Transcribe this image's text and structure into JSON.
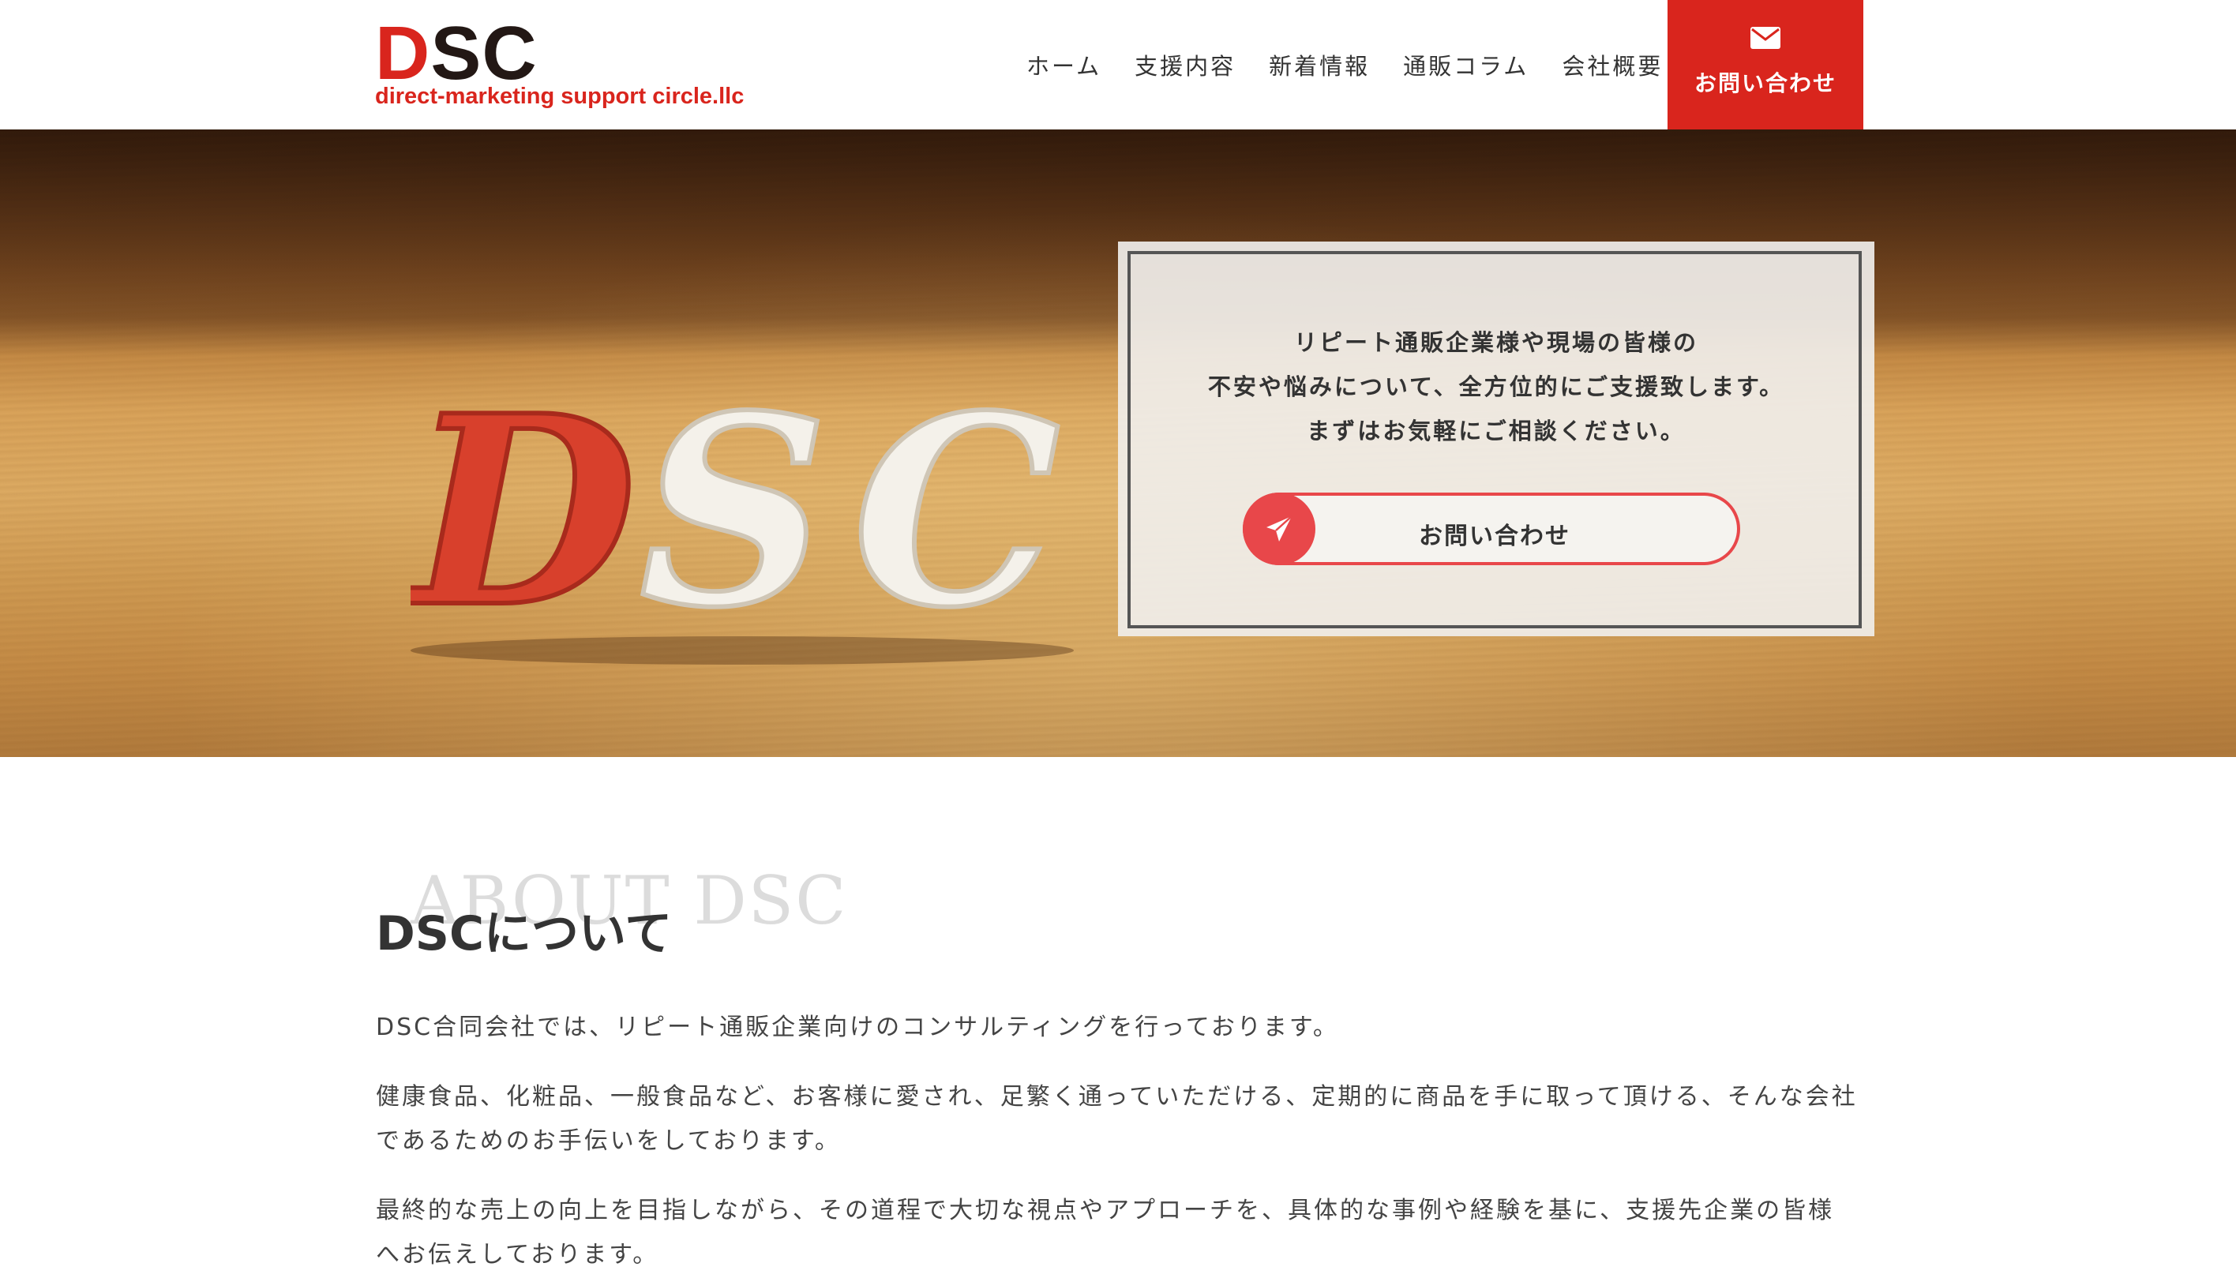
{
  "header": {
    "logo_mark_d": "D",
    "logo_mark_sc": "SC",
    "logo_sub": "direct-marketing support circle.llc",
    "nav": [
      "ホーム",
      "支援内容",
      "新着情報",
      "通販コラム",
      "会社概要"
    ],
    "contact_label": "お問い合わせ",
    "brand_color": "#d9251d"
  },
  "hero": {
    "letters": "DSC",
    "lines": [
      "リピート通販企業様や現場の皆様の",
      "不安や悩みについて、全方位的にご支援致します。",
      "まずはお気軽にご相談ください。"
    ],
    "button_label": "お問い合わせ",
    "button_color": "#e8474a"
  },
  "about": {
    "bg_title": "ABOUT DSC",
    "title": "DSCについて",
    "paragraphs": [
      "DSC合同会社では、リピート通販企業向けのコンサルティングを行っております。",
      "健康食品、化粧品、一般食品など、お客様に愛され、足繁く通っていただける、定期的に商品を手に取って頂ける、そんな会社であるためのお手伝いをしております。",
      "最終的な売上の向上を目指しながら、その道程で大切な視点やアプローチを、具体的な事例や経験を基に、支援先企業の皆様へお伝えしております。"
    ]
  },
  "icons": {
    "mail": "envelope-icon",
    "send": "paper-plane-icon"
  }
}
